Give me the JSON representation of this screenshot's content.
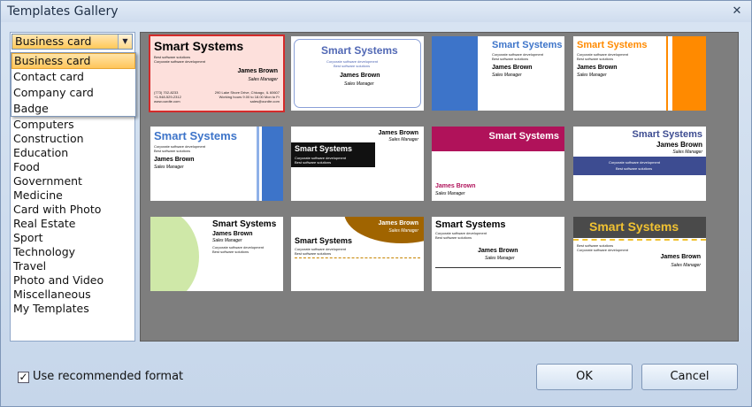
{
  "window": {
    "title": "Templates Gallery",
    "close_glyph": "✕"
  },
  "combo": {
    "selected": "Business card",
    "arrow_glyph": "▼"
  },
  "dropdown": {
    "options": [
      "Business card",
      "Contact card",
      "Company card",
      "Badge"
    ]
  },
  "categories": [
    "Computers",
    "Construction",
    "Education",
    "Food",
    "Government",
    "Medicine",
    "Card with Photo",
    "Real Estate",
    "Sport",
    "Technology",
    "Travel",
    "Photo and Video",
    "Miscellaneous",
    "My Templates"
  ],
  "cards": {
    "c1": {
      "company": "Smart Systems",
      "tag1": "Best software solutions",
      "tag2": "Corporate software development",
      "name": "James Brown",
      "role": "Sales Manager",
      "phone": "(773) 702-8233",
      "fax": "+1-948-529-2312",
      "web": "www.ourdte.com",
      "addr": "290 Lake Shore Drive, Chicago, IL 60607",
      "hours": "Working hours 9.00 to 18.00 Mon to Fr",
      "email": "sales@ourdte.com"
    },
    "c2": {
      "company": "Smart Systems",
      "tag1": "Corporate software development",
      "tag2": "Best software solutions",
      "name": "James Brown",
      "role": "Sales Manager"
    },
    "c3": {
      "company": "Smart Systems",
      "tag1": "Corporate software development",
      "tag2": "Best software solutions",
      "name": "James Brown",
      "role": "Sales Manager"
    },
    "c4": {
      "company": "Smart Systems",
      "tag1": "Corporate software development",
      "tag2": "Best software solutions",
      "name": "James Brown",
      "role": "Sales Manager"
    },
    "c5": {
      "company": "Smart Systems",
      "tag1": "Corporate software development",
      "tag2": "Best software solutions",
      "name": "James Brown",
      "role": "Sales Manager"
    },
    "c6": {
      "company": "Smart Systems",
      "tag1": "Corporate software development",
      "tag2": "Best software solutions",
      "name": "James Brown",
      "role": "Sales Manager"
    },
    "c7": {
      "company": "Smart Systems",
      "name": "James Brown",
      "role": "Sales Manager"
    },
    "c8": {
      "company": "Smart Systems",
      "name": "James Brown",
      "role": "Sales Manager",
      "banner1": "Corporate software development",
      "banner2": "Best software solutions"
    },
    "c9": {
      "company": "Smart Systems",
      "name": "James Brown",
      "role": "Sales Manager",
      "tag1": "Corporate software development",
      "tag2": "Best software solutions"
    },
    "c10": {
      "company": "Smart Systems",
      "name": "James Brown",
      "role": "Sales Manager",
      "tag1": "Corporate software development",
      "tag2": "Best software solutions"
    },
    "c11": {
      "company": "Smart Systems",
      "name": "James Brown",
      "role": "Sales Manager",
      "tag1": "Corporate software development",
      "tag2": "Best software solutions"
    },
    "c12": {
      "company": "Smart Systems",
      "name": "James Brown",
      "role": "Sales Manager",
      "tag1": "Best software solutions",
      "tag2": "Corporate software development"
    }
  },
  "footer": {
    "checkbox_label": "Use recommended format",
    "checked_glyph": "✓",
    "ok": "OK",
    "cancel": "Cancel"
  },
  "colors": {
    "selected_outline": "#d42a2a",
    "accent_blue": "#3d74c9",
    "accent_orange": "#ff8a00",
    "accent_magenta": "#b0125a",
    "accent_navy": "#3d4c91",
    "accent_gold": "#f1c232"
  }
}
